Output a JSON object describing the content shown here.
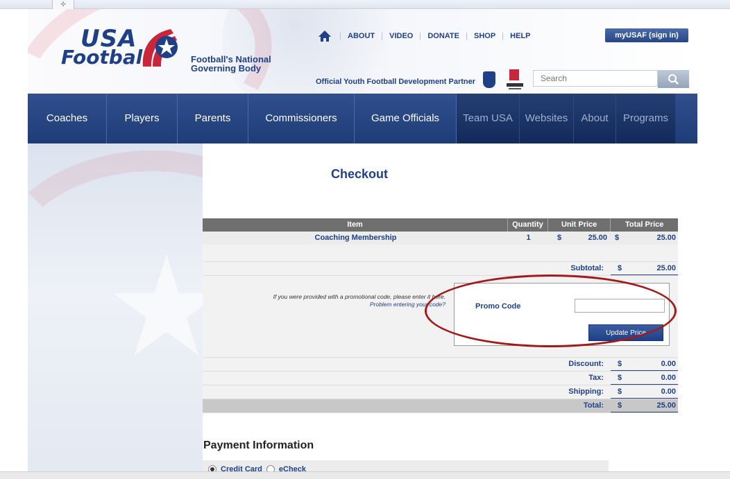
{
  "header": {
    "logo_top": "USA",
    "logo_bottom": "Football",
    "tagline_line1": "Football's National",
    "tagline_line2": "Governing Body",
    "top_nav": [
      "ABOUT",
      "VIDEO",
      "DONATE",
      "SHOP",
      "HELP"
    ],
    "signin_label": "myUSAF (sign in)",
    "partner_text": "Official Youth Football Development Partner",
    "search_placeholder": "Search"
  },
  "main_nav": [
    {
      "label": "Coaches"
    },
    {
      "label": "Players"
    },
    {
      "label": "Parents"
    },
    {
      "label": "Commissioners"
    },
    {
      "label": "Game Officials"
    },
    {
      "label": "Team USA"
    },
    {
      "label": "Websites"
    },
    {
      "label": "About"
    },
    {
      "label": "Programs"
    }
  ],
  "checkout": {
    "title": "Checkout",
    "columns": {
      "item": "Item",
      "quantity": "Quantity",
      "unit_price": "Unit Price",
      "total_price": "Total Price"
    },
    "line_item": {
      "name": "Coaching Membership",
      "quantity": "1",
      "unit_currency": "$",
      "unit_price": "25.00",
      "total_currency": "$",
      "total_price": "25.00"
    },
    "subtotal": {
      "label": "Subtotal:",
      "currency": "$",
      "amount": "25.00"
    },
    "promo": {
      "prompt": "If you were provided with a promotional code, please enter it here.",
      "help_link": "Problem entering your code?",
      "label": "Promo Code",
      "value": "",
      "button": "Update Price"
    },
    "discount": {
      "label": "Discount:",
      "currency": "$",
      "amount": "0.00"
    },
    "tax": {
      "label": "Tax:",
      "currency": "$",
      "amount": "0.00"
    },
    "shipping": {
      "label": "Shipping:",
      "currency": "$",
      "amount": "0.00"
    },
    "total": {
      "label": "Total:",
      "currency": "$",
      "amount": "25.00"
    }
  },
  "payment": {
    "title": "Payment Information",
    "options": [
      "Credit Card",
      "eCheck"
    ],
    "selected": "Credit Card"
  },
  "colors": {
    "brand_navy": "#1f3f87",
    "highlight_red": "#a01c1c"
  }
}
